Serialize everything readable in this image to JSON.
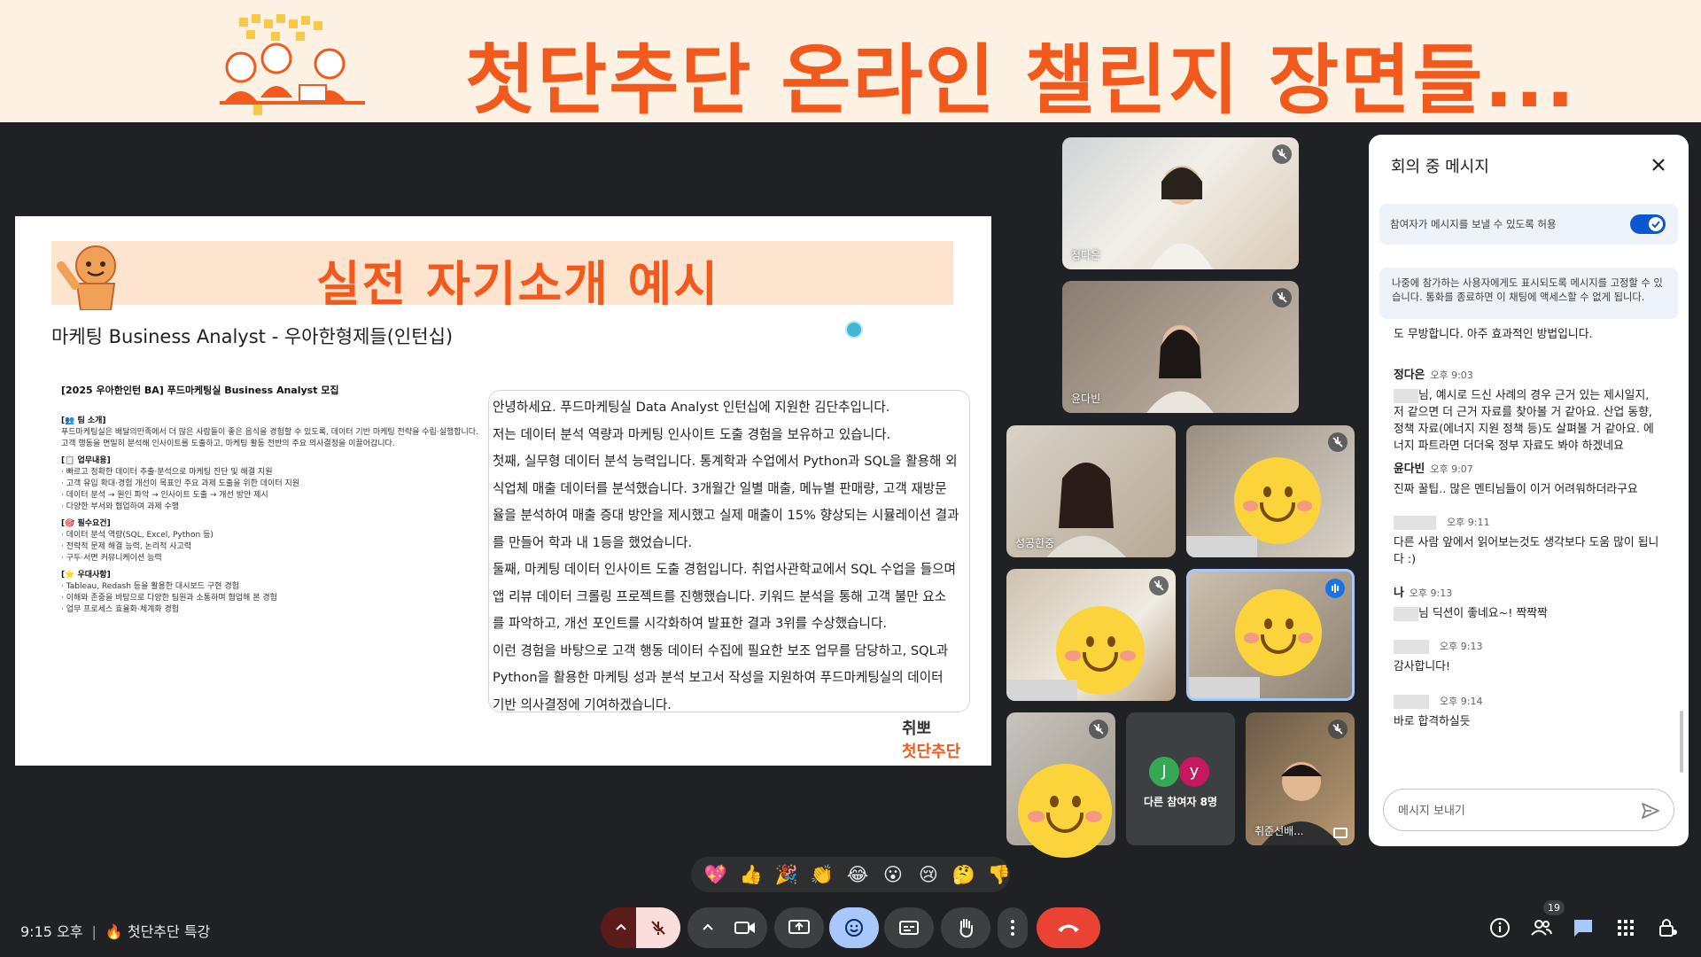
{
  "banner": {
    "title": "첫단추단 온라인 챌린지 장면들..."
  },
  "slide": {
    "title": "실전 자기소개 예시",
    "subtitle": "마케팅 Business Analyst - 우아한형제들(인턴십)",
    "posting": {
      "title": "[2025 우아한인턴 BA] 푸드마케팅실 Business Analyst 모집",
      "sections": [
        {
          "head": "[👥 팀 소개]",
          "lines": [
            "푸드마케팅실은 배달의민족에서 더 많은 사람들이 좋은 음식을 경험할 수 있도록, 데이터 기반 마케팅 전략을 수립·실행합니다.",
            "고객 행동을 면밀히 분석해 인사이트를 도출하고, 마케팅 활동 전반의 주요 의사결정을 이끌어갑니다."
          ]
        },
        {
          "head": "[📋 업무내용]",
          "lines": [
            "· 빠르고 정확한 데이터 추출·분석으로 마케팅 진단 및 해결 지원",
            "· 고객 유입 확대·경험 개선이 목표인 주요 과제 도출을 위한 데이터 지원",
            "· 데이터 분석 → 원인 파악 → 인사이트 도출 → 개선 방안 제시",
            "· 다양한 부서와 협업하여 과제 수행"
          ]
        },
        {
          "head": "[🎯 필수요건]",
          "lines": [
            "· 데이터 분석 역량(SQL, Excel, Python 등)",
            "· 전략적 문제 해결 능력, 논리적 사고력",
            "· 구두·서면 커뮤니케이션 능력"
          ]
        },
        {
          "head": "[⭐ 우대사항]",
          "lines": [
            "· Tableau, Redash 등을 활용한 대시보드 구현 경험",
            "· 이해와 존중을 바탕으로 다양한 팀원과 소통하며 협업해 본 경험",
            "· 업무 프로세스 효율화·체계화 경험"
          ]
        }
      ]
    },
    "intro_lines": [
      "안녕하세요. 푸드마케팅실 Data Analyst 인턴십에 지원한 김단추입니다.",
      "저는 데이터 분석 역량과 마케팅 인사이트 도출 경험을 보유하고 있습니다.",
      "첫째, 실무형 데이터 분석 능력입니다. 통계학과 수업에서 Python과 SQL을 활용해 외",
      "식업체 매출 데이터를 분석했습니다. 3개월간 일별 매출, 메뉴별 판매량, 고객 재방문",
      "율을 분석하여 매출 증대 방안을 제시했고 실제 매출이 15% 향상되는 시뮬레이션 결과",
      "를 만들어 학과 내 1등을 했었습니다.",
      "둘째, 마케팅 데이터 인사이트 도출 경험입니다. 취업사관학교에서 SQL 수업을 들으며",
      "앱 리뷰 데이터 크롤링 프로젝트를 진행했습니다. 키워드 분석을 통해 고객 불만 요소",
      "를 파악하고, 개선 포인트를 시각화하여 발표한 결과 3위를 수상했습니다.",
      "이런 경험을 바탕으로 고객 행동 데이터 수집에 필요한 보조 업무를 담당하고, SQL과",
      "Python을 활용한 마케팅 성과 분석 보고서 작성을 지원하여 푸드마케팅실의 데이터",
      "기반 의사결정에 기여하겠습니다."
    ],
    "logo_line1": "취뽀",
    "logo_line2": "첫단추단"
  },
  "tiles": {
    "t1": "정다은",
    "t2": "윤다빈",
    "t3": "성공한중",
    "t4": "",
    "t5": "",
    "t6": "",
    "t7": "",
    "others_label": "다른 참여자 8명",
    "others_avatars": [
      {
        "letter": "J",
        "color": "#34a853"
      },
      {
        "letter": "y",
        "color": "#c5185d"
      }
    ],
    "t9": "취준선배..."
  },
  "reactions": [
    "💖",
    "👍",
    "🎉",
    "👏",
    "😂",
    "😮",
    "😢",
    "🤔",
    "👎"
  ],
  "bottom": {
    "time": "9:15 오후",
    "meeting": "🔥 첫단추단 특강",
    "participants_count": "19"
  },
  "chat": {
    "title": "회의 중 메시지",
    "toggle_label": "참여자가 메시지를 보낼 수 있도록 허용",
    "toggle_on": true,
    "note": "나중에 참가하는 사용자에게도 표시되도록 메시지를 고정할 수 있습니다. 통화를 종료하면 이 채팅에 액세스할 수 없게 됩니다.",
    "partial_top": "도 무방합니다. 아주 효과적인 방법입니다.",
    "messages": [
      {
        "sender": "정다은",
        "time": "오후 9:03",
        "text": "님, 예시로 드신 사례의 경우 근거 있는 제시일지, 저 같으면 더 근거 자료를 찾아볼 거 같아요. 산업 동향, 정책 자료(에너지 지원 정책 등)도 살펴볼 거 같아요. 에너지 파트라면 더더욱 정부 자료도 봐야 하겠네요"
      },
      {
        "sender": "윤다빈",
        "time": "오후 9:07",
        "text": "진짜 꿀팁.. 많은 멘티님들이 이거 어려워하더라구요"
      },
      {
        "sender": "",
        "time": "오후 9:11",
        "text": "다른 사람 앞에서 읽어보는것도 생각보다 도움 많이 됩니다 :)"
      },
      {
        "sender": "나",
        "time": "오후 9:13",
        "text": "님 딕션이 좋네요~! 짝짝짝"
      },
      {
        "sender": "",
        "time": "오후 9:13",
        "text": "감사합니다!"
      },
      {
        "sender": "",
        "time": "오후 9:14",
        "text": "바로 합격하실듯"
      }
    ],
    "input_placeholder": "메시지 보내기"
  },
  "colors": {
    "accent": "#f2591c",
    "banner_bg": "#fdf1e4",
    "meet_bg": "#202124",
    "end_call": "#ea4335",
    "toggle_blue": "#0b57d0",
    "reaction_active": "#a8c7fa"
  }
}
